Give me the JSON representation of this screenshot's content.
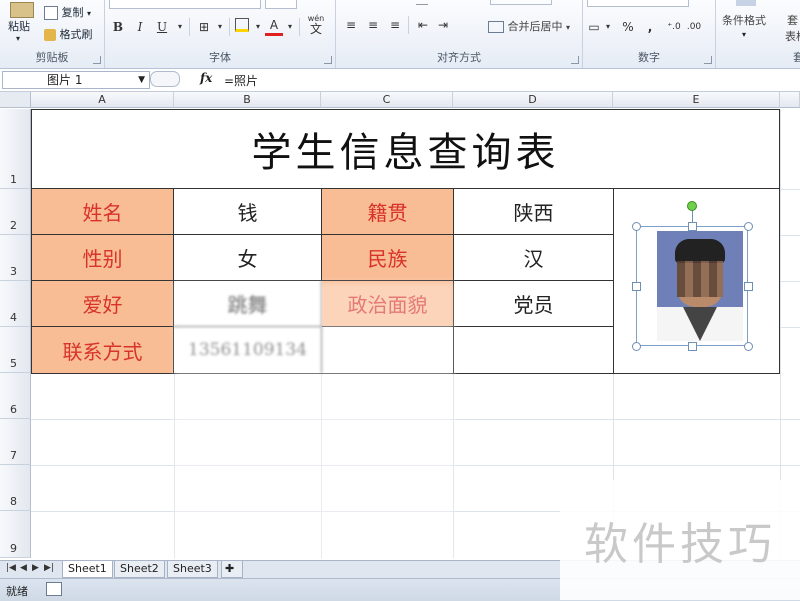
{
  "ribbon": {
    "clipboard": {
      "label": "剪贴板",
      "paste": "粘贴",
      "copy": "复制",
      "format_painter": "格式刷"
    },
    "font": {
      "label": "字体",
      "bold": "B",
      "italic": "I",
      "underline": "U",
      "font_color": "A",
      "wen": "wén"
    },
    "alignment": {
      "label": "对齐方式",
      "merge_center": "合并后居中"
    },
    "number": {
      "label": "数字",
      "percent": "%",
      "comma": ","
    },
    "styles": {
      "conditional_format": "条件格式",
      "table_format": "表格格"
    },
    "partial_tab": "套"
  },
  "formula_bar": {
    "name_box": "图片 1",
    "fx": "fx",
    "formula": "=照片"
  },
  "columns": [
    "A",
    "B",
    "C",
    "D",
    "E"
  ],
  "rows": [
    "1",
    "2",
    "3",
    "4",
    "5",
    "6",
    "7",
    "8",
    "9"
  ],
  "table": {
    "title": "学生信息查询表",
    "cells": [
      {
        "label": "姓名",
        "value": "钱",
        "label2": "籍贯",
        "value2": "陕西"
      },
      {
        "label": "性别",
        "value": "女",
        "label2": "民族",
        "value2": "汉"
      },
      {
        "label": "爱好",
        "value": "跳舞",
        "label2": "政治面貌",
        "value2": "党员"
      },
      {
        "label": "联系方式",
        "value": "13561109134",
        "label2": "",
        "value2": ""
      }
    ]
  },
  "sheets": [
    "Sheet1",
    "Sheet2",
    "Sheet3"
  ],
  "status": {
    "ready": "就绪"
  },
  "watermark": "软件技巧",
  "colors": {
    "label_bg": "#f9bd96",
    "label_text": "#d8332a"
  }
}
